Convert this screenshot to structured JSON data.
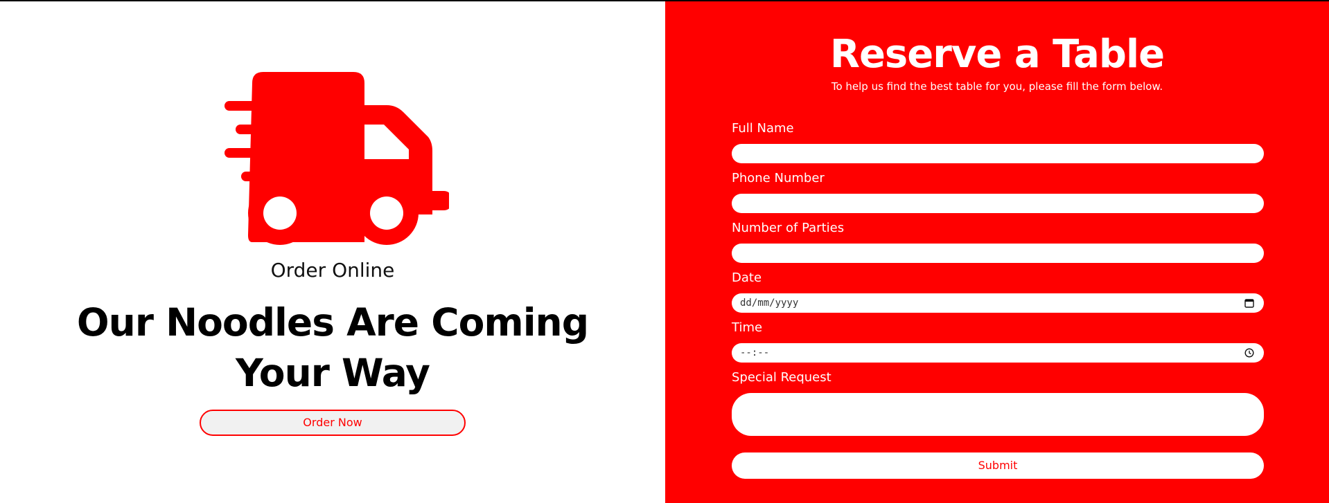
{
  "colors": {
    "accent": "#ff0000",
    "background": "#ffffff",
    "text": "#000000"
  },
  "left": {
    "icon": "delivery-truck-icon",
    "subtitle": "Order Online",
    "headline_line1": "Our Noodles Are Coming",
    "headline_line2": "Your Way",
    "button_label": "Order Now"
  },
  "reservation": {
    "title": "Reserve a Table",
    "subtitle": "To help us find the best table for you, please fill the form below.",
    "fields": {
      "full_name": {
        "label": "Full Name",
        "value": ""
      },
      "phone": {
        "label": "Phone Number",
        "value": ""
      },
      "parties": {
        "label": "Number of Parties",
        "value": ""
      },
      "date": {
        "label": "Date",
        "placeholder": "dd/mm/yyyy",
        "icon": "calendar-icon"
      },
      "time": {
        "label": "Time",
        "placeholder": "--:--",
        "icon": "clock-icon"
      },
      "special": {
        "label": "Special Request",
        "value": ""
      }
    },
    "submit_label": "Submit"
  }
}
